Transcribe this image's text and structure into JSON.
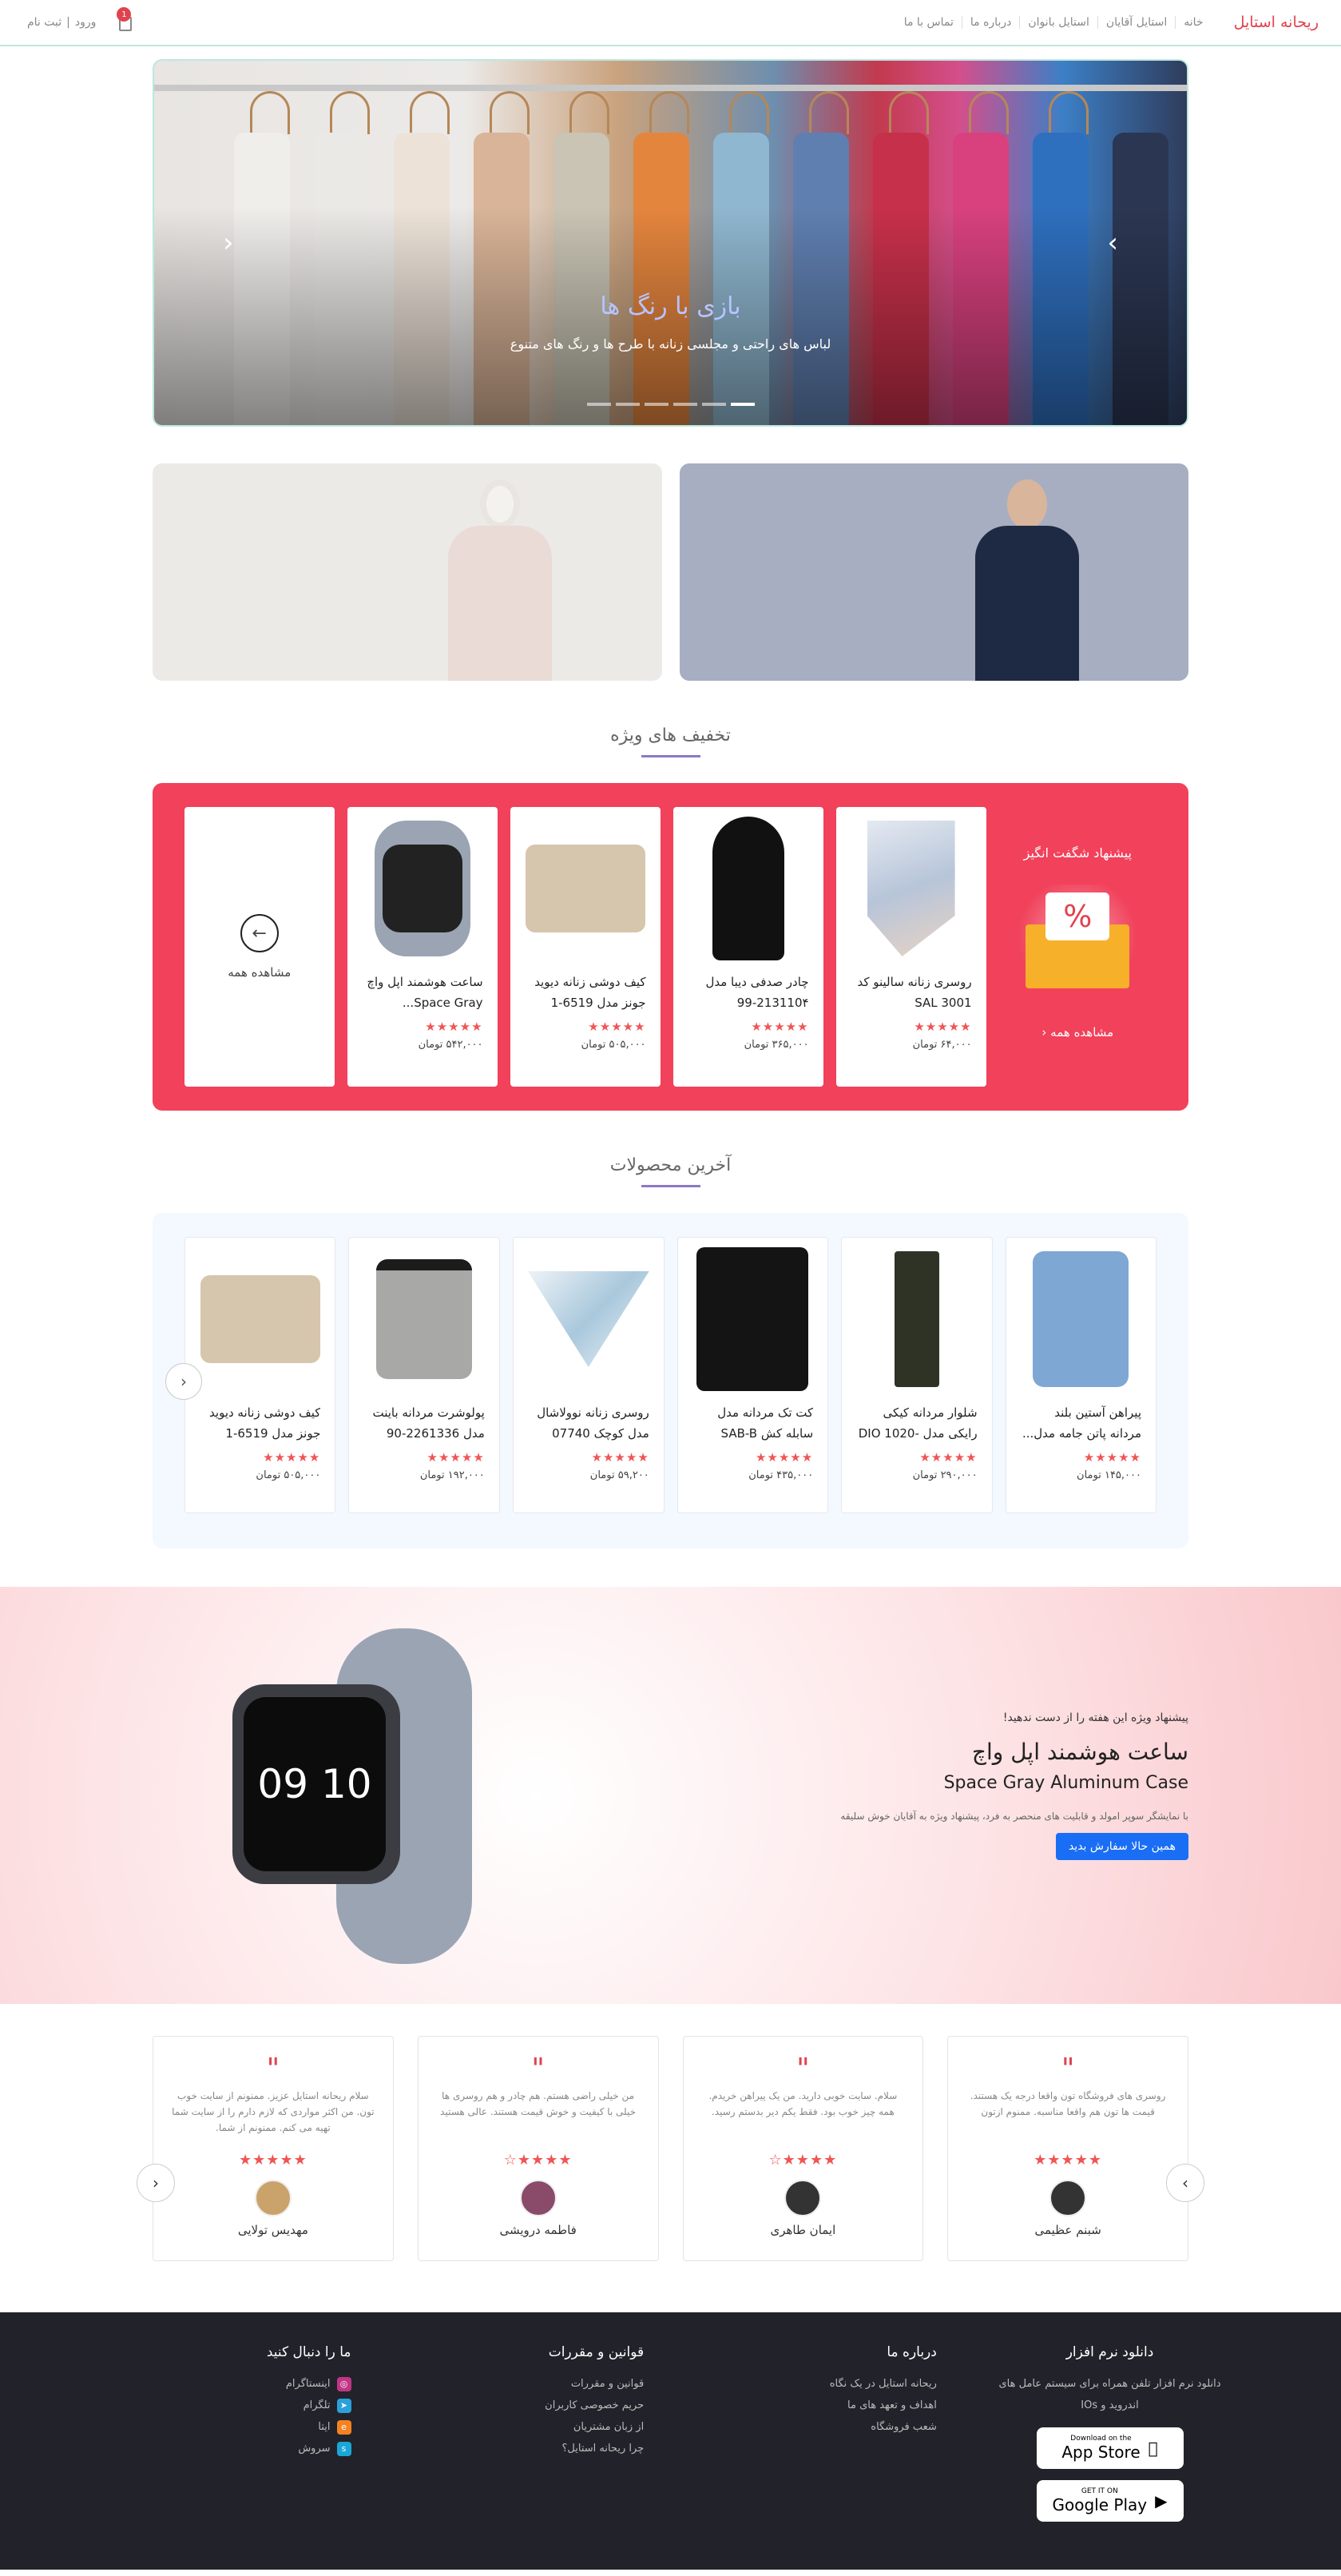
{
  "header": {
    "brand": "ریحانه استایل",
    "nav": [
      "خانه",
      "استایل آقایان",
      "استایل بانوان",
      "درباره ما",
      "تماس با ما"
    ],
    "cart_count": "1",
    "login": "ورود",
    "register": "ثبت نام"
  },
  "hero": {
    "title": "بازی با رنگ ها",
    "subtitle": "لباس های راحتی و مجلسی زنانه با طرح ها و رنگ های متنوع",
    "slides": 6,
    "active_slide": 0
  },
  "deals": {
    "section_title": "تخفیف های ویژه",
    "promo_title": "پیشنهاد شگفت انگیز",
    "promo_seeall": "مشاهده همه",
    "view_all": "مشاهده همه",
    "products": [
      {
        "name": "روسری زنانه سالینو کد SAL 3001",
        "price": "۶۴,۰۰۰ تومان",
        "rating": 5,
        "img": "scarf-icon"
      },
      {
        "name": "چادر صدفی دیبا مدل 213110۴-99",
        "price": "۳۶۵,۰۰۰ تومان",
        "rating": 5,
        "img": "chador-icon"
      },
      {
        "name": "کیف دوشی زنانه دیوید جونز مدل 6519-1",
        "price": "۵۰۵,۰۰۰ تومان",
        "rating": 5,
        "img": "bag-icon"
      },
      {
        "name": "ساعت هوشمند اپل واچ Space Gray...",
        "price": "۵۴۲,۰۰۰ تومان",
        "rating": 5,
        "img": "watch-icon"
      }
    ]
  },
  "latest": {
    "section_title": "آخرین محصولات",
    "products": [
      {
        "name": "پیراهن آستین بلند مردانه پاتن جامه مدل...",
        "price": "۱۴۵,۰۰۰ تومان",
        "rating": 5,
        "img": "shirt-icon"
      },
      {
        "name": "شلوار مردانه کیکی رایکی مدل DIO 1020-04",
        "price": "۲۹۰,۰۰۰ تومان",
        "rating": 5,
        "img": "pants-icon"
      },
      {
        "name": "کت تک مردانه مدل سابله کش SAB-B",
        "price": "۴۳۵,۰۰۰ تومان",
        "rating": 5,
        "img": "jacket-icon"
      },
      {
        "name": "روسری زنانه نوولاشال مدل کوچک 07740",
        "price": "۵۹,۲۰۰ تومان",
        "rating": 5,
        "img": "scarf-icon"
      },
      {
        "name": "پولوشرت مردانه باینت مدل 2261336-90",
        "price": "۱۹۲,۰۰۰ تومان",
        "rating": 5,
        "img": "polo-icon"
      },
      {
        "name": "کیف دوشی زنانه دیوید جونز مدل 6519-1",
        "price": "۵۰۵,۰۰۰ تومان",
        "rating": 5,
        "img": "bag-icon"
      }
    ]
  },
  "feature": {
    "small": "پیشنهاد ویژه این هفته را از دست ندهید!",
    "title": "ساعت هوشمند اپل واچ",
    "subtitle": "Space Gray Aluminum Case",
    "desc": "با نمایشگر سوپر امولد و قابلیت های منحصر به فرد، پیشنهاد ویژه به آقایان خوش سلیقه",
    "button": "همین حالا سفارش بدید",
    "watch_time": "10 09"
  },
  "reviews": [
    {
      "text": "روسری های فروشگاه تون واقعا درجه یک هستند. قیمت ها تون هم واقعا مناسبه. ممنوم ازتون",
      "rating": 5,
      "name": "شبنم عظیمی"
    },
    {
      "text": "سلام. سایت خوبی دارید. من یک پیراهن خریدم. همه چیز خوب بود. فقط یکم دیر بدستم رسید.",
      "rating": 4,
      "name": "ایمان طاهری"
    },
    {
      "text": "من خیلی راضی هستم. هم چادر و هم روسری ها خیلی با کیفیت و خوش قیمت هستند. عالی هستید",
      "rating": 4,
      "name": "فاطمه درویشی"
    },
    {
      "text": "سلام ریحانه استایل عزیز. ممنونم از سایت خوب تون. من اکثر مواردی که لازم دارم را از سایت شما تهیه می کنم. ممنونم از شما.",
      "rating": 5,
      "name": "مهدیس تولایی"
    }
  ],
  "footer": {
    "app": {
      "title": "دانلود نرم افزار",
      "desc": "دانلود نرم افزار تلفن همراه برای سیستم عامل های اندروید و IOs",
      "appstore_small": "Download on the",
      "appstore": "App Store",
      "gplay_small": "GET IT ON",
      "gplay": "Google Play"
    },
    "about": {
      "title": "درباره ما",
      "items": [
        "ریحانه استایل در یک نگاه",
        "اهداف و تعهد های ما",
        "شعب فروشگاه"
      ]
    },
    "rules": {
      "title": "قوانین و مقررات",
      "items": [
        "قوانین و مقررات",
        "حریم خصوصی کاربران",
        "از زبان مشتریان",
        "چرا ریحانه استایل؟"
      ]
    },
    "follow": {
      "title": "ما را دنبال کنید",
      "items": [
        {
          "label": "اینستاگرام",
          "icon": "instagram-icon",
          "color": "#c13584"
        },
        {
          "label": "تلگرام",
          "icon": "telegram-icon",
          "color": "#2aa1da"
        },
        {
          "label": "ایتا",
          "icon": "eitaa-icon",
          "color": "#f58220"
        },
        {
          "label": "سروش",
          "icon": "soroush-icon",
          "color": "#1aa7d8"
        }
      ]
    }
  }
}
